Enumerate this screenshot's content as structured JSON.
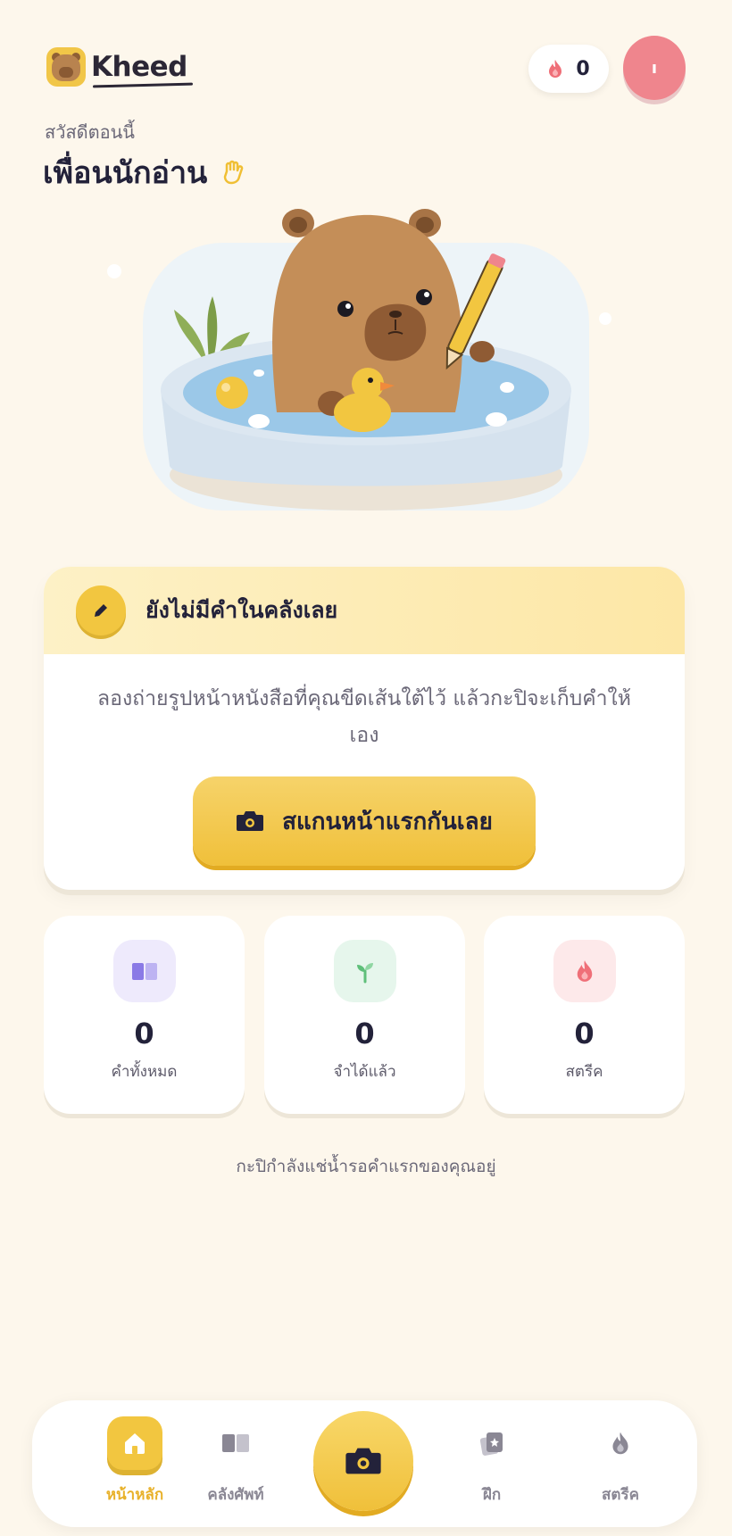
{
  "app": {
    "name": "Kheed"
  },
  "header": {
    "streak_count": "0",
    "avatar_initial": "ı",
    "greeting_sub": "สวัสดีตอนนี้",
    "greeting_title": "เพื่อนนักอ่าน"
  },
  "empty_state": {
    "title": "ยังไม่มีคำในคลังเลย",
    "text": "ลองถ่ายรูปหน้าหนังสือที่คุณขีดเส้นใต้ไว้ แล้วกะปิจะเก็บคำให้เอง",
    "button_label": "สแกนหน้าแรกกันเลย"
  },
  "stats": [
    {
      "value": "0",
      "label": "คำทั้งหมด",
      "icon": "book-icon"
    },
    {
      "value": "0",
      "label": "จำได้แล้ว",
      "icon": "sprout-icon"
    },
    {
      "value": "0",
      "label": "สตรีค",
      "icon": "flame-icon"
    }
  ],
  "footer_note": "กะปิกำลังแช่น้ำรอคำแรกของคุณอยู่",
  "nav": {
    "home": "หน้าหลัก",
    "library": "คลังศัพท์",
    "practice": "ฝึก",
    "streak": "สตรีค"
  },
  "colors": {
    "background": "#fdf7ec",
    "accent": "#f2c640",
    "avatar": "#ef858d",
    "text": "#23223a"
  }
}
